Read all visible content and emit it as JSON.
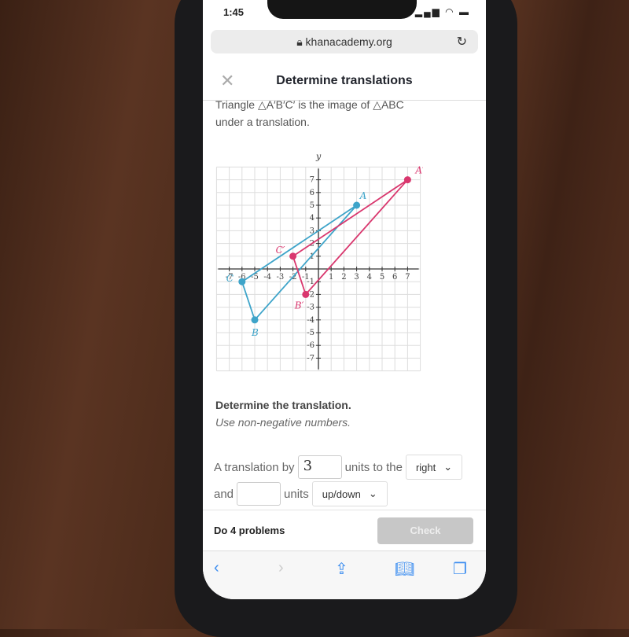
{
  "status": {
    "time": "1:45",
    "icons": "signal wifi battery"
  },
  "browser": {
    "url": "khanacademy.org",
    "lock_icon": "lock-icon",
    "reload_icon": "reload-icon"
  },
  "header": {
    "title": "Determine translations",
    "close_icon": "close-icon"
  },
  "prompt": {
    "line1": "Triangle △A′B′C′ is the image of △ABC",
    "line2": "under a translation."
  },
  "graph": {
    "xlabel": "x",
    "ylabel": "y",
    "xlim": [
      -8,
      8
    ],
    "ylim": [
      -8,
      8
    ],
    "ticks": [
      -7,
      -6,
      -5,
      -4,
      -3,
      -2,
      -1,
      1,
      2,
      3,
      4,
      5,
      6,
      7
    ],
    "original": {
      "color": "#3ea4c9",
      "points": [
        {
          "label": "A",
          "x": 3,
          "y": 5
        },
        {
          "label": "B",
          "x": -5,
          "y": -4
        },
        {
          "label": "C",
          "x": -6,
          "y": -1
        }
      ]
    },
    "image": {
      "color": "#d9376e",
      "points": [
        {
          "label": "A′",
          "x": 7,
          "y": 7
        },
        {
          "label": "B′",
          "x": -1,
          "y": -2
        },
        {
          "label": "C′",
          "x": -2,
          "y": 1
        }
      ]
    }
  },
  "question": {
    "title": "Determine the translation.",
    "hint": "Use non-negative numbers."
  },
  "answer": {
    "prefix": "A translation by",
    "value1": "3",
    "mid": "units to the",
    "dir1": "right",
    "and": "and",
    "value2": "",
    "units": "units",
    "dir2": "up/down"
  },
  "footer": {
    "progress": "Do 4 problems",
    "check": "Check"
  },
  "toolbar": {
    "back": "‹",
    "forward": "›"
  }
}
